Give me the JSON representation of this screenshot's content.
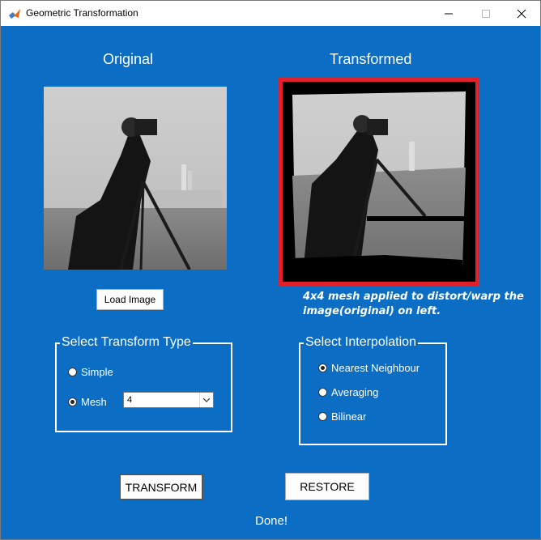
{
  "window": {
    "title": "Geometric Transformation"
  },
  "headings": {
    "original": "Original",
    "transformed": "Transformed"
  },
  "buttons": {
    "load_image": "Load Image",
    "transform": "TRANSFORM",
    "restore": "RESTORE"
  },
  "note": {
    "line1": "4x4 mesh applied to distort/warp the",
    "line2": "image(original) on left."
  },
  "transform_panel": {
    "title": "Select Transform Type",
    "options": [
      "Simple",
      "Mesh"
    ],
    "selected": "Mesh",
    "mesh_select_value": "4"
  },
  "interp_panel": {
    "title": "Select Interpolation",
    "options": [
      "Nearest Neighbour",
      "Averaging",
      "Bilinear"
    ],
    "selected": "Nearest Neighbour"
  },
  "status": "Done!",
  "colors": {
    "background": "#0b6dc3",
    "highlight_border": "#e0202a"
  }
}
